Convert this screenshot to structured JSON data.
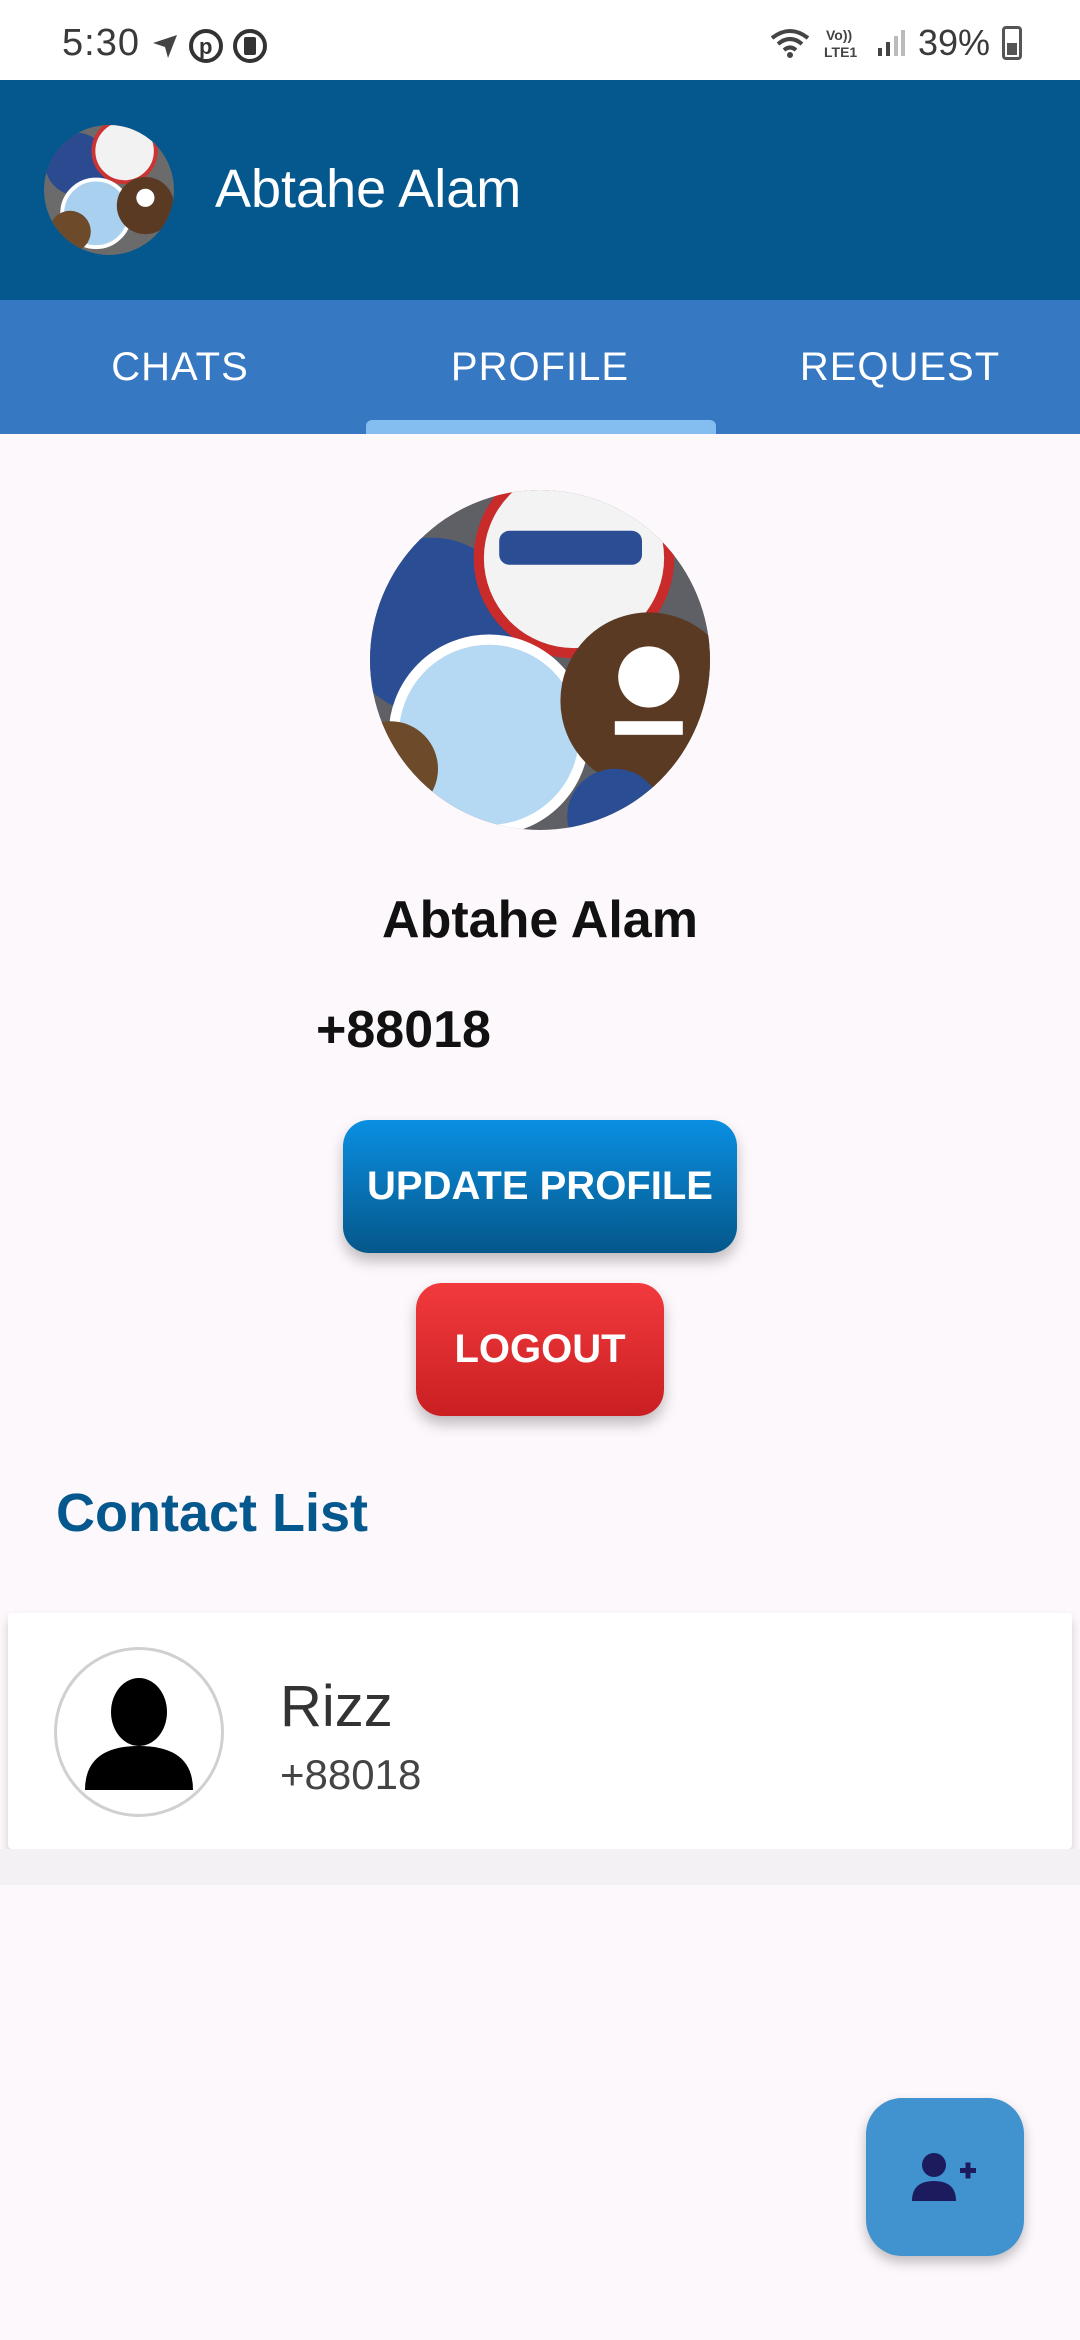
{
  "status_bar": {
    "time": "5:30",
    "battery": "39%",
    "icons": [
      "navigation-icon",
      "p-app-icon",
      "clipboard-icon",
      "wifi-call-icon",
      "volte-icon",
      "signal-icon",
      "battery-icon"
    ]
  },
  "app_bar": {
    "title": "Abtahe Alam",
    "avatar_icon": "bottle-caps-avatar"
  },
  "tabs": [
    {
      "label": "CHATS",
      "active": false
    },
    {
      "label": "PROFILE",
      "active": true
    },
    {
      "label": "REQUEST",
      "active": false
    }
  ],
  "profile": {
    "name": "Abtahe Alam",
    "phone": "+88018",
    "photo_icon": "bottle-caps-photo"
  },
  "buttons": {
    "update_profile": "UPDATE PROFILE",
    "logout": "LOGOUT"
  },
  "contact_list": {
    "title": "Contact List",
    "items": [
      {
        "name": "Rizz",
        "phone": "+88018"
      }
    ]
  },
  "fab": {
    "icon": "add-person-icon"
  },
  "colors": {
    "app_bar": "#05588d",
    "tab_bar": "#3778c2",
    "accent_blue": "#0a8fe2",
    "logout_red": "#e12c2f",
    "fab": "#4193cf"
  }
}
